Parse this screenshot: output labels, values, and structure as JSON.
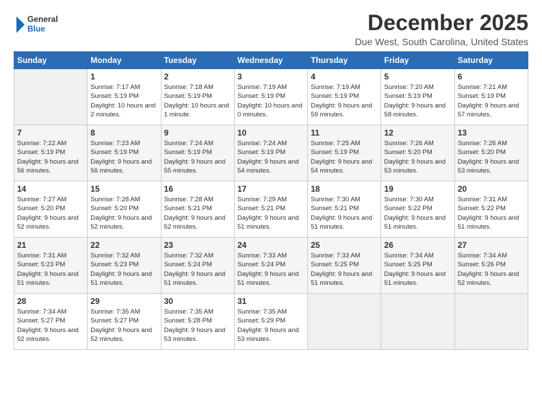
{
  "logo": {
    "line1": "General",
    "line2": "Blue"
  },
  "title": "December 2025",
  "location": "Due West, South Carolina, United States",
  "days_header": [
    "Sunday",
    "Monday",
    "Tuesday",
    "Wednesday",
    "Thursday",
    "Friday",
    "Saturday"
  ],
  "weeks": [
    [
      {
        "day": "",
        "sunrise": "",
        "sunset": "",
        "daylight": "",
        "empty": true
      },
      {
        "day": "1",
        "sunrise": "Sunrise: 7:17 AM",
        "sunset": "Sunset: 5:19 PM",
        "daylight": "Daylight: 10 hours and 2 minutes."
      },
      {
        "day": "2",
        "sunrise": "Sunrise: 7:18 AM",
        "sunset": "Sunset: 5:19 PM",
        "daylight": "Daylight: 10 hours and 1 minute."
      },
      {
        "day": "3",
        "sunrise": "Sunrise: 7:19 AM",
        "sunset": "Sunset: 5:19 PM",
        "daylight": "Daylight: 10 hours and 0 minutes."
      },
      {
        "day": "4",
        "sunrise": "Sunrise: 7:19 AM",
        "sunset": "Sunset: 5:19 PM",
        "daylight": "Daylight: 9 hours and 59 minutes."
      },
      {
        "day": "5",
        "sunrise": "Sunrise: 7:20 AM",
        "sunset": "Sunset: 5:19 PM",
        "daylight": "Daylight: 9 hours and 58 minutes."
      },
      {
        "day": "6",
        "sunrise": "Sunrise: 7:21 AM",
        "sunset": "Sunset: 5:19 PM",
        "daylight": "Daylight: 9 hours and 57 minutes."
      }
    ],
    [
      {
        "day": "7",
        "sunrise": "Sunrise: 7:22 AM",
        "sunset": "Sunset: 5:19 PM",
        "daylight": "Daylight: 9 hours and 56 minutes."
      },
      {
        "day": "8",
        "sunrise": "Sunrise: 7:23 AM",
        "sunset": "Sunset: 5:19 PM",
        "daylight": "Daylight: 9 hours and 56 minutes."
      },
      {
        "day": "9",
        "sunrise": "Sunrise: 7:24 AM",
        "sunset": "Sunset: 5:19 PM",
        "daylight": "Daylight: 9 hours and 55 minutes."
      },
      {
        "day": "10",
        "sunrise": "Sunrise: 7:24 AM",
        "sunset": "Sunset: 5:19 PM",
        "daylight": "Daylight: 9 hours and 54 minutes."
      },
      {
        "day": "11",
        "sunrise": "Sunrise: 7:25 AM",
        "sunset": "Sunset: 5:19 PM",
        "daylight": "Daylight: 9 hours and 54 minutes."
      },
      {
        "day": "12",
        "sunrise": "Sunrise: 7:26 AM",
        "sunset": "Sunset: 5:20 PM",
        "daylight": "Daylight: 9 hours and 53 minutes."
      },
      {
        "day": "13",
        "sunrise": "Sunrise: 7:26 AM",
        "sunset": "Sunset: 5:20 PM",
        "daylight": "Daylight: 9 hours and 53 minutes."
      }
    ],
    [
      {
        "day": "14",
        "sunrise": "Sunrise: 7:27 AM",
        "sunset": "Sunset: 5:20 PM",
        "daylight": "Daylight: 9 hours and 52 minutes."
      },
      {
        "day": "15",
        "sunrise": "Sunrise: 7:28 AM",
        "sunset": "Sunset: 5:20 PM",
        "daylight": "Daylight: 9 hours and 52 minutes."
      },
      {
        "day": "16",
        "sunrise": "Sunrise: 7:28 AM",
        "sunset": "Sunset: 5:21 PM",
        "daylight": "Daylight: 9 hours and 52 minutes."
      },
      {
        "day": "17",
        "sunrise": "Sunrise: 7:29 AM",
        "sunset": "Sunset: 5:21 PM",
        "daylight": "Daylight: 9 hours and 51 minutes."
      },
      {
        "day": "18",
        "sunrise": "Sunrise: 7:30 AM",
        "sunset": "Sunset: 5:21 PM",
        "daylight": "Daylight: 9 hours and 51 minutes."
      },
      {
        "day": "19",
        "sunrise": "Sunrise: 7:30 AM",
        "sunset": "Sunset: 5:22 PM",
        "daylight": "Daylight: 9 hours and 51 minutes."
      },
      {
        "day": "20",
        "sunrise": "Sunrise: 7:31 AM",
        "sunset": "Sunset: 5:22 PM",
        "daylight": "Daylight: 9 hours and 51 minutes."
      }
    ],
    [
      {
        "day": "21",
        "sunrise": "Sunrise: 7:31 AM",
        "sunset": "Sunset: 5:23 PM",
        "daylight": "Daylight: 9 hours and 51 minutes."
      },
      {
        "day": "22",
        "sunrise": "Sunrise: 7:32 AM",
        "sunset": "Sunset: 5:23 PM",
        "daylight": "Daylight: 9 hours and 51 minutes."
      },
      {
        "day": "23",
        "sunrise": "Sunrise: 7:32 AM",
        "sunset": "Sunset: 5:24 PM",
        "daylight": "Daylight: 9 hours and 51 minutes."
      },
      {
        "day": "24",
        "sunrise": "Sunrise: 7:33 AM",
        "sunset": "Sunset: 5:24 PM",
        "daylight": "Daylight: 9 hours and 51 minutes."
      },
      {
        "day": "25",
        "sunrise": "Sunrise: 7:33 AM",
        "sunset": "Sunset: 5:25 PM",
        "daylight": "Daylight: 9 hours and 51 minutes."
      },
      {
        "day": "26",
        "sunrise": "Sunrise: 7:34 AM",
        "sunset": "Sunset: 5:25 PM",
        "daylight": "Daylight: 9 hours and 51 minutes."
      },
      {
        "day": "27",
        "sunrise": "Sunrise: 7:34 AM",
        "sunset": "Sunset: 5:26 PM",
        "daylight": "Daylight: 9 hours and 52 minutes."
      }
    ],
    [
      {
        "day": "28",
        "sunrise": "Sunrise: 7:34 AM",
        "sunset": "Sunset: 5:27 PM",
        "daylight": "Daylight: 9 hours and 52 minutes."
      },
      {
        "day": "29",
        "sunrise": "Sunrise: 7:35 AM",
        "sunset": "Sunset: 5:27 PM",
        "daylight": "Daylight: 9 hours and 52 minutes."
      },
      {
        "day": "30",
        "sunrise": "Sunrise: 7:35 AM",
        "sunset": "Sunset: 5:28 PM",
        "daylight": "Daylight: 9 hours and 53 minutes."
      },
      {
        "day": "31",
        "sunrise": "Sunrise: 7:35 AM",
        "sunset": "Sunset: 5:29 PM",
        "daylight": "Daylight: 9 hours and 53 minutes."
      },
      {
        "day": "",
        "sunrise": "",
        "sunset": "",
        "daylight": "",
        "empty": true
      },
      {
        "day": "",
        "sunrise": "",
        "sunset": "",
        "daylight": "",
        "empty": true
      },
      {
        "day": "",
        "sunrise": "",
        "sunset": "",
        "daylight": "",
        "empty": true
      }
    ]
  ]
}
